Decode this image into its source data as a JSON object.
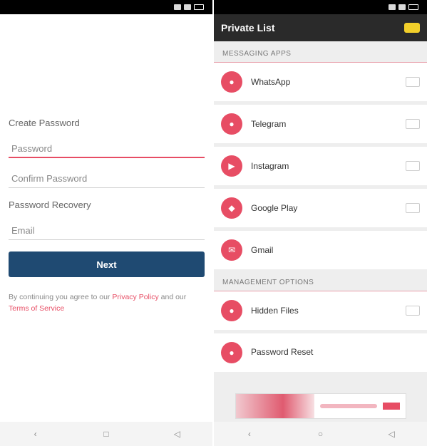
{
  "left": {
    "statusbar": {
      "time": ""
    },
    "section_password_label": "Create Password",
    "password_field": {
      "placeholder": "Password",
      "value": ""
    },
    "confirm_field": {
      "placeholder": "Confirm Password",
      "value": ""
    },
    "section_recovery_label": "Password Recovery",
    "email_field": {
      "placeholder": "Email",
      "value": ""
    },
    "submit_label": "Next",
    "terms": {
      "prefix": "By continuing you agree to our",
      "privacy_link": "Privacy Policy",
      "middle": "and our",
      "terms_link": "Terms of Service"
    }
  },
  "right": {
    "topbar_title": "Private List",
    "groups": [
      {
        "header": "Messaging Apps",
        "items": [
          {
            "title": "WhatsApp",
            "count": ""
          },
          {
            "title": "Telegram",
            "count": ""
          },
          {
            "title": "Instagram",
            "count": ""
          },
          {
            "title": "Google Play",
            "count": ""
          },
          {
            "title": "Gmail",
            "count": ""
          }
        ]
      },
      {
        "header": "Management Options",
        "items": [
          {
            "title": "Hidden Files",
            "count": ""
          },
          {
            "title": "Password Reset",
            "sub": ""
          }
        ]
      }
    ]
  },
  "colors": {
    "accent": "#e74d64",
    "primary_button": "#1f4a72",
    "topbar": "#2a2a2a",
    "badge": "#f2cf2a"
  }
}
